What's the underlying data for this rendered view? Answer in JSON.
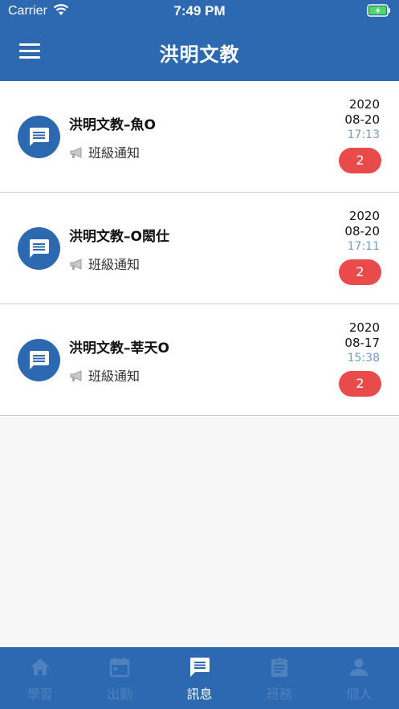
{
  "status": {
    "carrier": "Carrier",
    "time": "7:49 PM"
  },
  "header": {
    "title": "洪明文教"
  },
  "messages": [
    {
      "title": "洪明文教–魚O",
      "subtitle": "班級通知",
      "date_year": "2020",
      "date_md": "08-20",
      "time": "17:13",
      "badge": "2"
    },
    {
      "title": "洪明文教–O閎仕",
      "subtitle": "班級通知",
      "date_year": "2020",
      "date_md": "08-20",
      "time": "17:11",
      "badge": "2"
    },
    {
      "title": "洪明文教–莘天O",
      "subtitle": "班級通知",
      "date_year": "2020",
      "date_md": "08-17",
      "time": "15:38",
      "badge": "2"
    }
  ],
  "tabs": [
    {
      "label": "學習",
      "icon": "home-icon"
    },
    {
      "label": "出勤",
      "icon": "calendar-icon"
    },
    {
      "label": "訊息",
      "icon": "message-icon",
      "active": true
    },
    {
      "label": "班務",
      "icon": "clipboard-icon"
    },
    {
      "label": "個人",
      "icon": "person-icon"
    }
  ],
  "colors": {
    "primary": "#2c69b0",
    "badge": "#e94b4b",
    "time": "#6f9dcc",
    "inactive_tab": "#4f82bd"
  }
}
